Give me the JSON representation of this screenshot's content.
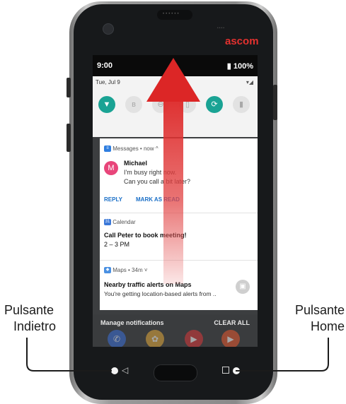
{
  "device": {
    "brand": "ascom",
    "accent_color": "#e3312f"
  },
  "status_bar": {
    "time": "9:00",
    "battery": "100%",
    "battery_icon": "battery-icon"
  },
  "quick_settings": {
    "date": "Tue, Jul 9",
    "tiles": [
      {
        "icon": "wifi-icon",
        "state": "on"
      },
      {
        "icon": "bluetooth-icon",
        "state": "off"
      },
      {
        "icon": "dnd-icon",
        "state": "off"
      },
      {
        "icon": "flashlight-icon",
        "state": "off"
      },
      {
        "icon": "auto-rotate-icon",
        "state": "on"
      },
      {
        "icon": "battery-saver-icon",
        "state": "off"
      }
    ]
  },
  "notifications": {
    "messages": {
      "header": "Messages • now ^",
      "sender": "Michael",
      "avatar_letter": "M",
      "line1": "I'm busy right now.",
      "line2": "Can you call a bit later?",
      "actions": [
        "REPLY",
        "MARK AS READ"
      ]
    },
    "calendar": {
      "header": "Calendar",
      "title": "Call Peter to book meeting!",
      "time": "2 – 3 PM"
    },
    "maps": {
      "header": "Maps • 34m ˅",
      "title": "Nearby traffic alerts on Maps",
      "text": "You're getting location-based alerts from .."
    }
  },
  "bottom_bar": {
    "manage": "Manage notifications",
    "clear_all": "CLEAR ALL"
  },
  "callouts": {
    "left": {
      "line1": "Pulsante",
      "line2": "Indietro"
    },
    "right": {
      "line1": "Pulsante",
      "line2": "Home"
    }
  },
  "nav": {
    "back_icon": "◁",
    "back_glyph": "back-icon",
    "recent_glyph": "recent-apps-icon"
  }
}
